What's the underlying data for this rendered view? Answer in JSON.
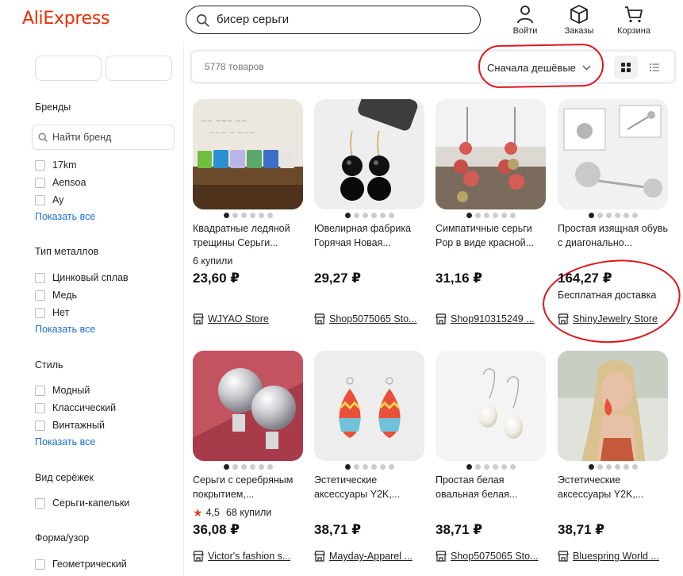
{
  "header": {
    "logo": "AliExpress",
    "search_value": "бисер серьги",
    "nav": [
      {
        "label": "Войти",
        "icon": "user-icon"
      },
      {
        "label": "Заказы",
        "icon": "box-icon"
      },
      {
        "label": "Корзина",
        "icon": "cart-icon"
      }
    ]
  },
  "sidebar": {
    "brands_title": "Бренды",
    "brand_search_placeholder": "Найти бренд",
    "brands": [
      "17km",
      "Aensoa",
      "Ay"
    ],
    "show_all": "Показать все",
    "metal_title": "Тип металлов",
    "metals": [
      "Цинковый сплав",
      "Медь",
      "Нет"
    ],
    "style_title": "Стиль",
    "styles": [
      "Модный",
      "Классический",
      "Винтажный"
    ],
    "earring_title": "Вид серёжек",
    "earrings": [
      "Серьги-капельки"
    ],
    "shape_title": "Форма/узор",
    "shapes": [
      "Геометрический"
    ]
  },
  "toolbar": {
    "count": "5778 товаров",
    "sort_label": "Сначала дешёвые"
  },
  "products": [
    {
      "title": "Квадратные ледяной трещины Серьги...",
      "sold": "6 купили",
      "price": "23,60 ₽",
      "store": "WJYAO Store"
    },
    {
      "title": "Ювелирная фабрика Горячая Новая...",
      "price": "29,27 ₽",
      "store": "Shop5075065 Sto..."
    },
    {
      "title": "Симпатичные серьги Pop в виде красной...",
      "price": "31,16 ₽",
      "store": "Shop910315249 ..."
    },
    {
      "title": "Простая изящная обувь с диагонально...",
      "price": "164,27 ₽",
      "shipping": "Бесплатная доставка",
      "store": "ShinyJewelry Store"
    },
    {
      "title": "Серьги с серебряным покрытием,...",
      "rating": "4,5",
      "sold": "68 купили",
      "price": "36,08 ₽",
      "store": "Victor's fashion s..."
    },
    {
      "title": "Эстетические аксессуары Y2K,...",
      "price": "38,71 ₽",
      "store": "Mayday-Apparel ..."
    },
    {
      "title": "Простая белая овальная белая...",
      "price": "38,71 ₽",
      "store": "Shop5075065 Sto..."
    },
    {
      "title": "Эстетические аксессуары Y2K,...",
      "price": "38,71 ₽",
      "store": "Bluespring World ..."
    }
  ],
  "colors": {
    "brand": "#e62e04",
    "link": "#1a6fd6",
    "annotation": "#e0161b"
  }
}
